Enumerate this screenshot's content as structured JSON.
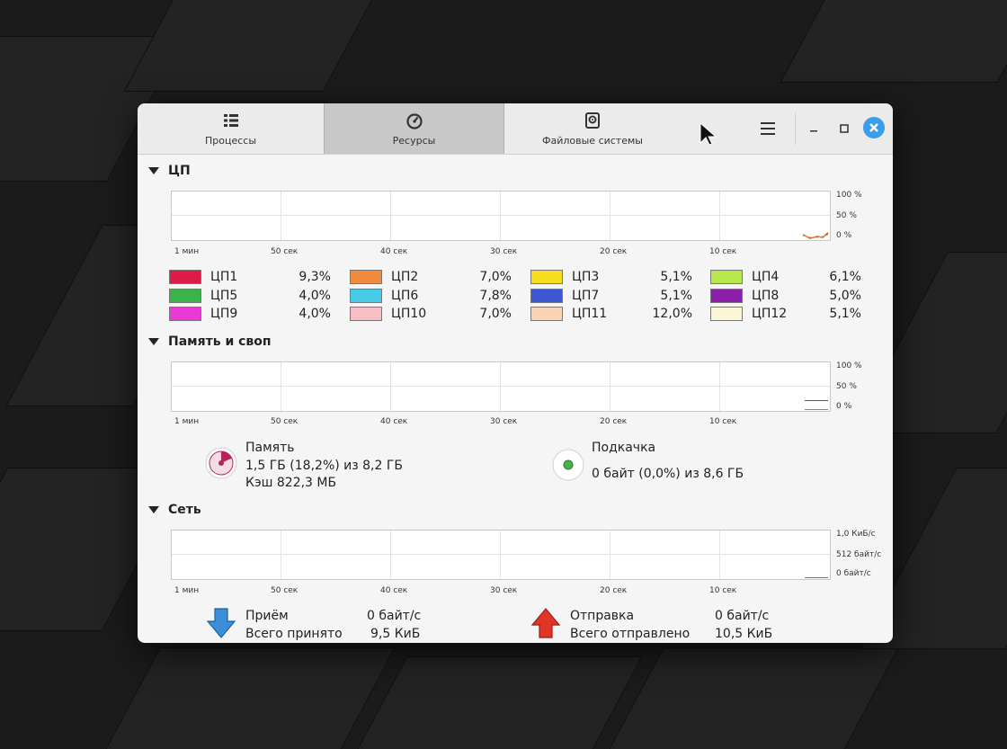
{
  "tabs": [
    {
      "label": "Процессы",
      "icon": "list-icon"
    },
    {
      "label": "Ресурсы",
      "icon": "gauge-icon"
    },
    {
      "label": "Файловые системы",
      "icon": "disk-icon"
    }
  ],
  "active_tab": "Ресурсы",
  "time_ticks": [
    "1 мин",
    "50 сек",
    "40 сек",
    "30 сек",
    "20 сек",
    "10 сек"
  ],
  "cpu": {
    "title": "ЦП",
    "y_labels": [
      "100 %",
      "50 %",
      "0 %"
    ],
    "cores": [
      {
        "name": "ЦП1",
        "value": "9,3%",
        "color": "#dc1b4b"
      },
      {
        "name": "ЦП2",
        "value": "7,0%",
        "color": "#f08a3c"
      },
      {
        "name": "ЦП3",
        "value": "5,1%",
        "color": "#f6dd1e"
      },
      {
        "name": "ЦП4",
        "value": "6,1%",
        "color": "#b6e84e"
      },
      {
        "name": "ЦП5",
        "value": "4,0%",
        "color": "#3cb34a"
      },
      {
        "name": "ЦП6",
        "value": "7,8%",
        "color": "#46cbe8"
      },
      {
        "name": "ЦП7",
        "value": "5,1%",
        "color": "#3b57d4"
      },
      {
        "name": "ЦП8",
        "value": "5,0%",
        "color": "#8b1fa8"
      },
      {
        "name": "ЦП9",
        "value": "4,0%",
        "color": "#e83ad6"
      },
      {
        "name": "ЦП10",
        "value": "7,0%",
        "color": "#f7bfc4"
      },
      {
        "name": "ЦП11",
        "value": "12,0%",
        "color": "#f8d3b6"
      },
      {
        "name": "ЦП12",
        "value": "5,1%",
        "color": "#fbf6d5"
      }
    ]
  },
  "memory": {
    "title": "Память и своп",
    "y_labels": [
      "100 %",
      "50 %",
      "0 %"
    ],
    "mem_label": "Память",
    "mem_used": "1,5 ГБ (18,2%) из 8,2 ГБ",
    "mem_cache": "Кэш 822,3 МБ",
    "mem_fraction": 0.182,
    "mem_color": "#b4245a",
    "swap_label": "Подкачка",
    "swap_used": "0 байт (0,0%) из 8,6 ГБ",
    "swap_fraction": 0.0,
    "swap_color": "#4caf50"
  },
  "network": {
    "title": "Сеть",
    "y_labels": [
      "1,0 КиБ/с",
      "512 байт/с",
      "0 байт/с"
    ],
    "recv_label": "Приём",
    "recv_rate": "0 байт/с",
    "recv_total_label": "Всего принято",
    "recv_total": "9,5 КиБ",
    "send_label": "Отправка",
    "send_rate": "0 байт/с",
    "send_total_label": "Всего отправлено",
    "send_total": "10,5 КиБ"
  }
}
